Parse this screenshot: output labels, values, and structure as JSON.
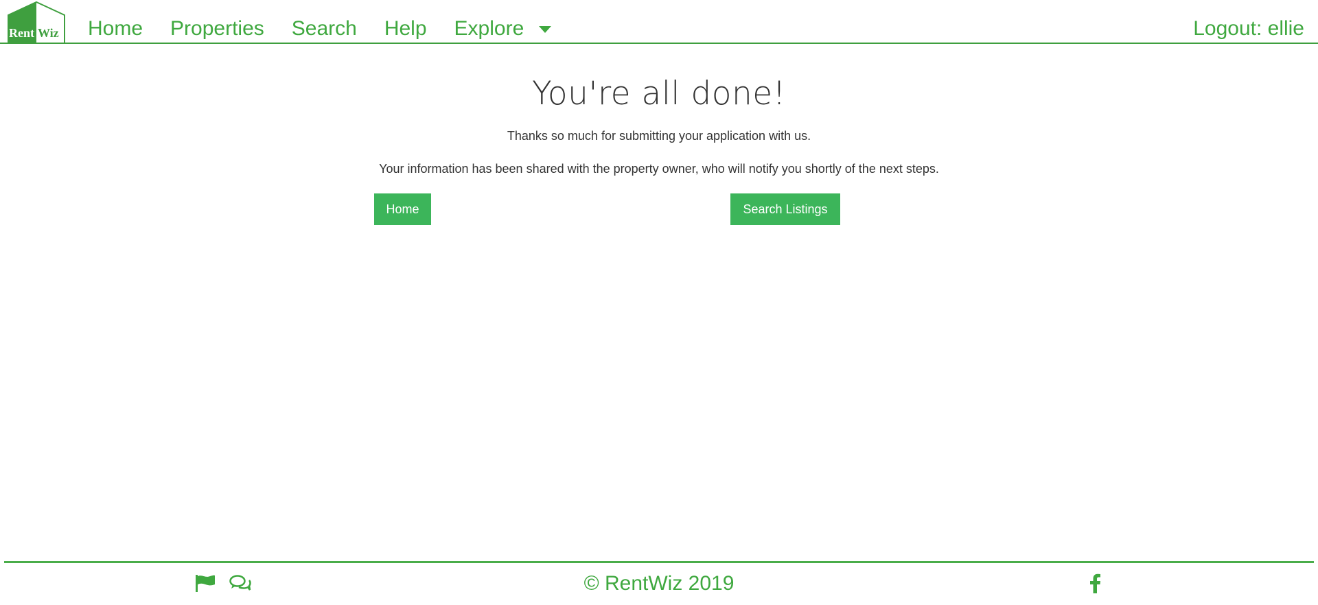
{
  "brand": {
    "logo_text_rent": "Rent",
    "logo_text_wiz": "Wiz",
    "color": "#3fa83f"
  },
  "nav": {
    "items": [
      {
        "label": "Home"
      },
      {
        "label": "Properties"
      },
      {
        "label": "Search"
      },
      {
        "label": "Help"
      }
    ],
    "dropdown": {
      "label": "Explore",
      "icon": "caret-down-icon"
    },
    "logout_label": "Logout: ellie"
  },
  "main": {
    "headline": "You're all done!",
    "message_1": "Thanks so much for submitting your application with us.",
    "message_2": "Your information has been shared with the property owner, who will notify you shortly of the next steps.",
    "home_button": "Home",
    "search_button": "Search Listings",
    "button_color": "#3cb55a"
  },
  "footer": {
    "copyright": "© RentWiz 2019",
    "icons": [
      "flag-icon",
      "chat-icon",
      "facebook-icon"
    ]
  }
}
